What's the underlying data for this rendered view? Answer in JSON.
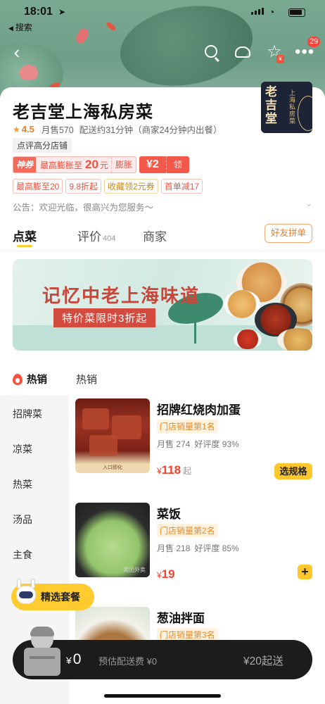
{
  "status_bar": {
    "time": "18:01",
    "back_app": "搜索"
  },
  "nav": {
    "message_badge": "29"
  },
  "shop": {
    "name": "老吉堂上海私房菜",
    "logo_text_big": "老吉堂",
    "logo_text_small": "上海私房菜",
    "rating": "4.5",
    "monthly_sales": "月售570",
    "delivery": "配送约31分钟（商家24分钟内出餐）",
    "tag": "点评高分店铺",
    "notice": "公告：欢迎光临，很高兴为您服务～"
  },
  "coupon": {
    "shen": "神券",
    "desc": "最高膨胀至",
    "amount": "20",
    "unit": "元",
    "pengzhang": "膨胀",
    "voucher": "¥2",
    "get": "领"
  },
  "promos": [
    "最高膨至20",
    "9.8折起",
    "收藏领2元券",
    "首单减17"
  ],
  "tabs": [
    {
      "label": "点菜",
      "count": ""
    },
    {
      "label": "评价",
      "count": "404"
    },
    {
      "label": "商家",
      "count": ""
    }
  ],
  "group_buy_label": "好友拼单",
  "banner": {
    "title": "记忆中老上海味道",
    "subtitle": "特价菜限时3折起"
  },
  "menu": {
    "active_category": "热销",
    "section_title": "热销",
    "categories": [
      "招牌菜",
      "凉菜",
      "热菜",
      "汤品",
      "主食"
    ],
    "items": [
      {
        "name": "招牌红烧肉加蛋",
        "rank": "门店销量第1名",
        "sales": "月售 274",
        "praise": "好评度 93%",
        "price": "118",
        "currency": "¥",
        "suffix": "起",
        "action": "选规格",
        "img_label": "入口即化"
      },
      {
        "name": "菜饭",
        "rank": "门店销量第2名",
        "sales": "月售 218",
        "praise": "好评度 85%",
        "price": "19",
        "currency": "¥",
        "suffix": "",
        "action": "+",
        "img_label": "美团外卖"
      },
      {
        "name": "葱油拌面",
        "rank": "门店销量第3名",
        "sales": "",
        "praise": "",
        "price": "",
        "currency": "",
        "suffix": "",
        "action": "",
        "img_label": ""
      }
    ]
  },
  "combo_label": "精选套餐",
  "cart": {
    "currency": "¥",
    "amount": "0",
    "fee": "预估配送费 ¥0",
    "min_order": "¥20起送"
  },
  "colors": {
    "accent_yellow": "#ffc72c",
    "price_red": "#f2442d",
    "rank_orange": "#e8892a"
  }
}
